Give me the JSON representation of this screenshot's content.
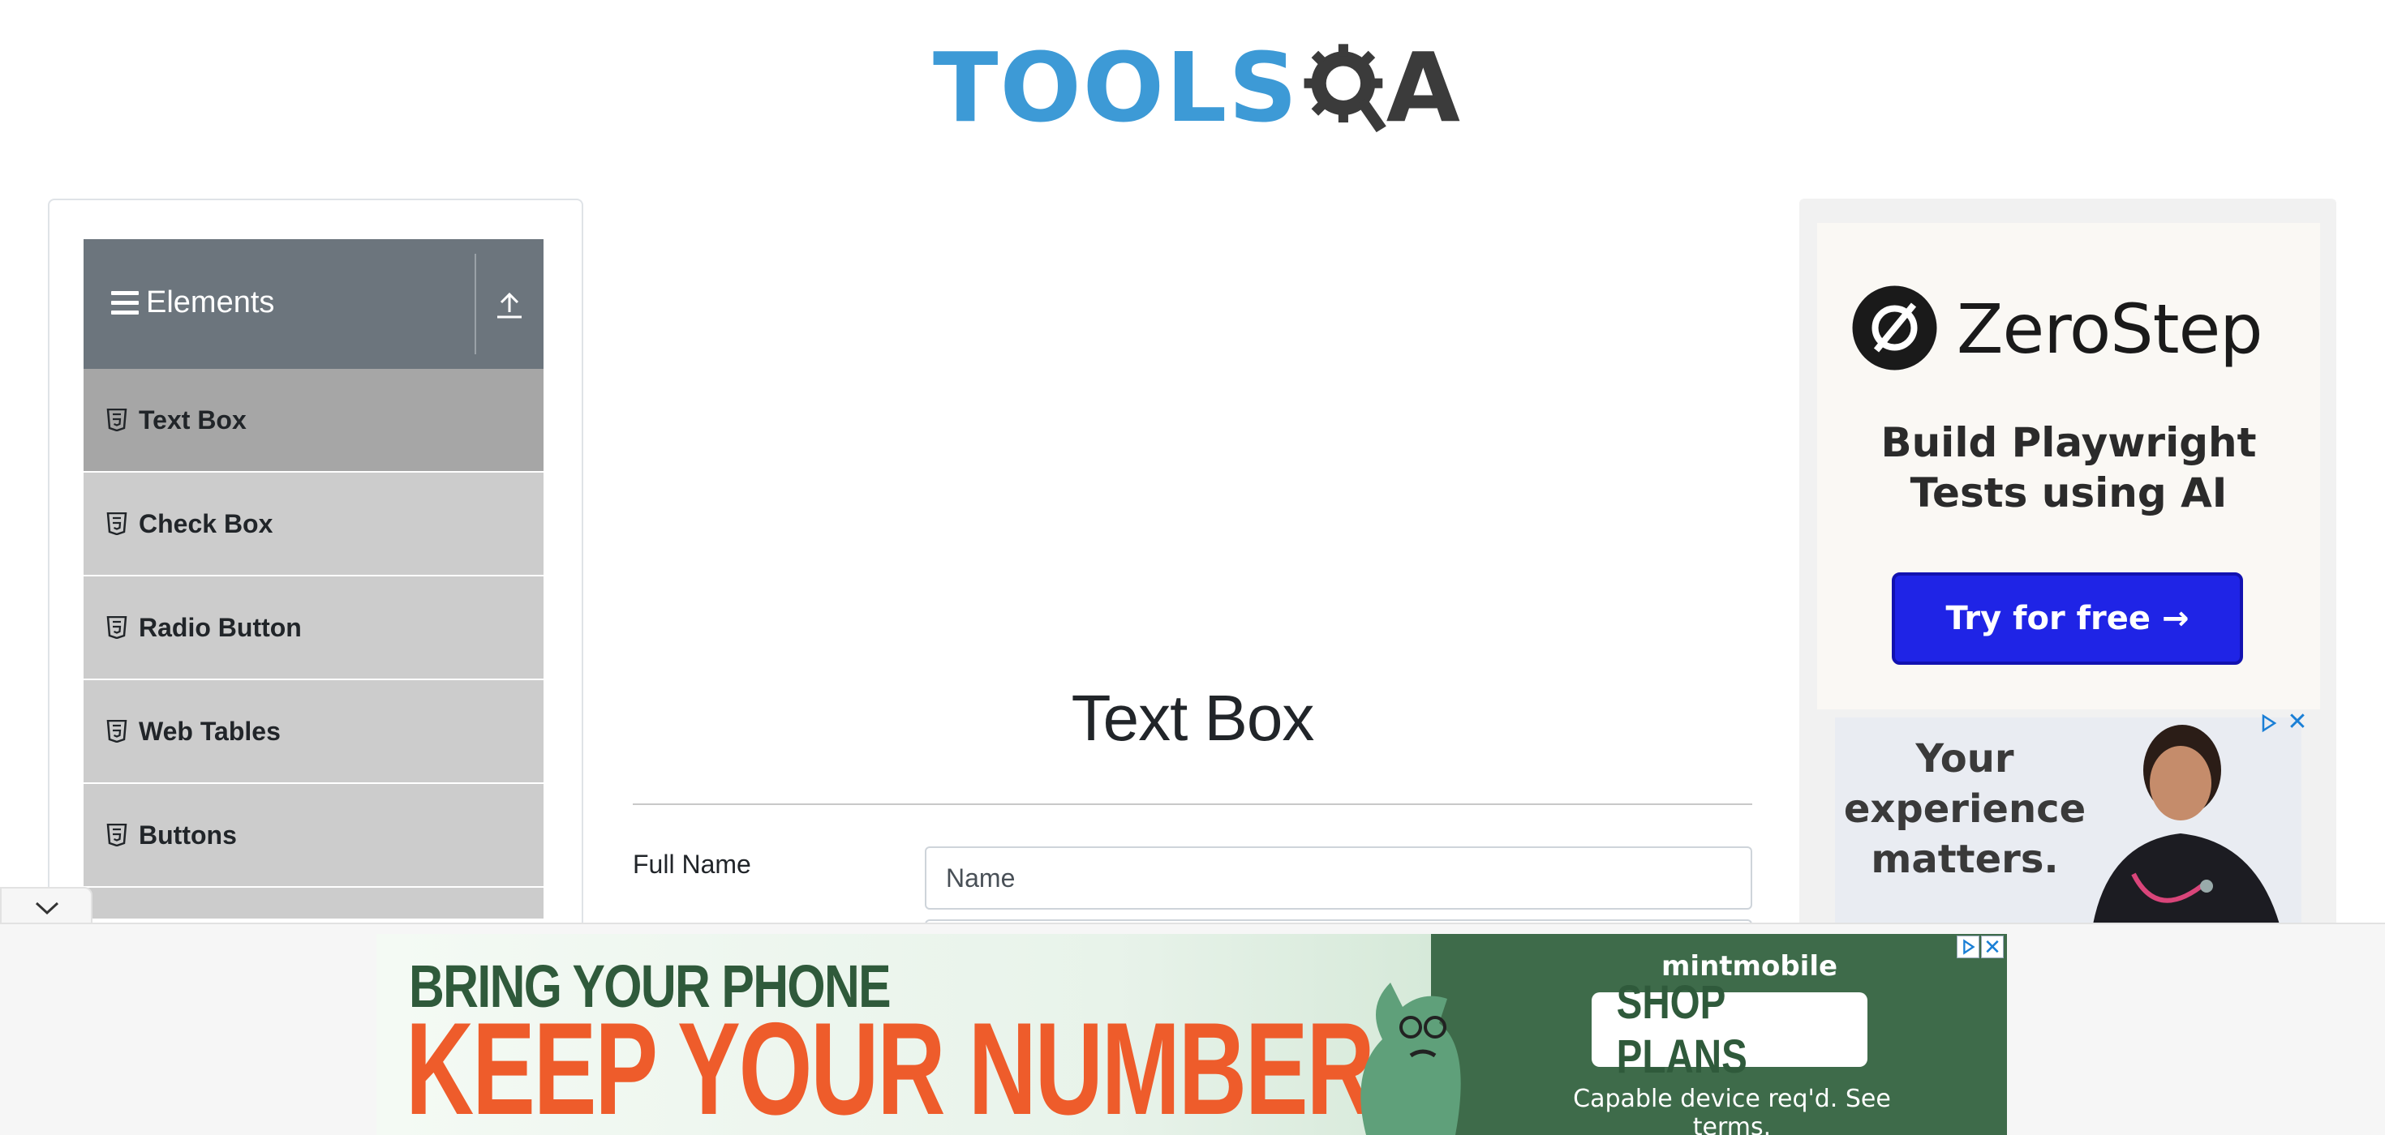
{
  "header": {
    "logo_tools": "TOOLS",
    "logo_a": "A",
    "brand_colors": {
      "tools_blue": "#3d9ad6",
      "qa_dark": "#3b3b3b"
    }
  },
  "sidebar": {
    "group_title": "Elements",
    "group_icon": "hamburger-icon",
    "collapse_icon": "upload-icon",
    "items": [
      {
        "label": "Text Box",
        "icon": "html5-icon",
        "active": true
      },
      {
        "label": "Check Box",
        "icon": "html5-icon",
        "active": false
      },
      {
        "label": "Radio Button",
        "icon": "html5-icon",
        "active": false
      },
      {
        "label": "Web Tables",
        "icon": "html5-icon",
        "active": false
      },
      {
        "label": "Buttons",
        "icon": "html5-icon",
        "active": false
      }
    ]
  },
  "main": {
    "title": "Text Box",
    "form": {
      "full_name_label": "Full Name",
      "full_name_placeholder": "Name"
    }
  },
  "right_ad": {
    "brand": "ZeroStep",
    "tagline": "Build Playwright Tests using AI",
    "cta": "Try for free →",
    "cta_color": "#1f24e6",
    "secondary_text": "Your experience matters."
  },
  "bottom_banner": {
    "line1": "BRING YOUR PHONE",
    "line2": "KEEP YOUR NUMBER",
    "brand": "mintmobile",
    "cta": "SHOP PLANS",
    "terms": "Capable device req'd. See terms.",
    "close_symbol": "✕",
    "colors": {
      "orange": "#ee5c2b",
      "green": "#3e6b4a"
    }
  }
}
